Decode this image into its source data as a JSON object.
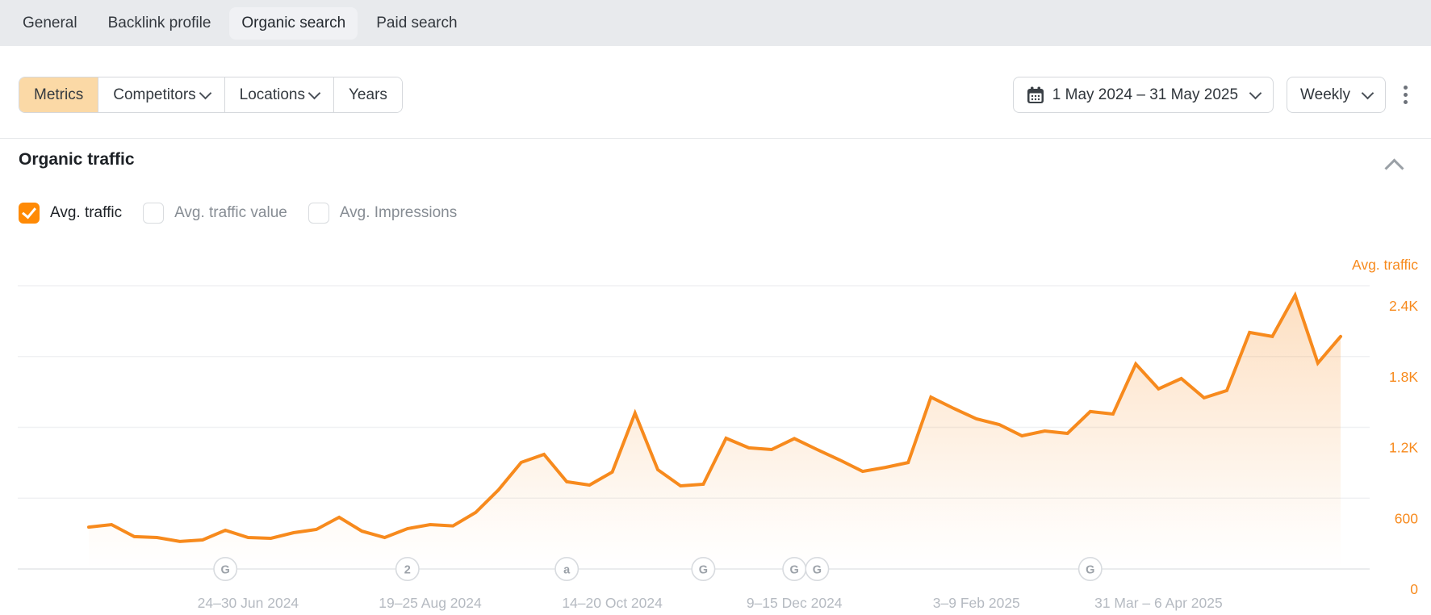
{
  "tabs": [
    {
      "label": "General",
      "active": false
    },
    {
      "label": "Backlink profile",
      "active": false
    },
    {
      "label": "Organic search",
      "active": true
    },
    {
      "label": "Paid search",
      "active": false
    }
  ],
  "toolbar": {
    "segments": [
      {
        "label": "Metrics",
        "active": true
      },
      {
        "label": "Competitors",
        "has_chevron": true
      },
      {
        "label": "Locations",
        "has_chevron": true
      },
      {
        "label": "Years"
      }
    ],
    "date_range": "1 May 2024 – 31 May 2025",
    "granularity": "Weekly"
  },
  "section": {
    "title": "Organic traffic"
  },
  "legend": {
    "checkboxes": [
      {
        "label": "Avg. traffic",
        "checked": true
      },
      {
        "label": "Avg. traffic value",
        "checked": false
      },
      {
        "label": "Avg. Impressions",
        "checked": false
      }
    ]
  },
  "colors": {
    "accent": "#f78a1d",
    "accent_soft": "#fbd9a6",
    "checkbox_checked": "#ff8a05",
    "grid": "#f0f1f3",
    "axis_line": "#e4e6e9",
    "x_label": "#b5bac1",
    "badge_border": "#d8dbdf",
    "badge_text": "#9ca2a9"
  },
  "chart_data": {
    "type": "area",
    "title": "Organic traffic",
    "x_unit": "week",
    "x_range_label": "1 May 2024 – 31 May 2025",
    "series": [
      {
        "name": "Avg. traffic",
        "values": [
          355,
          376,
          274,
          267,
          233,
          246,
          328,
          267,
          260,
          308,
          335,
          438,
          321,
          267,
          342,
          376,
          365,
          479,
          670,
          903,
          971,
          739,
          711,
          821,
          1320,
          841,
          704,
          718,
          1108,
          1026,
          1012,
          1105,
          1012,
          923,
          827,
          861,
          902,
          1456,
          1361,
          1272,
          1224,
          1128,
          1169,
          1149,
          1334,
          1313,
          1737,
          1526,
          1614,
          1450,
          1512,
          2004,
          1970,
          2319,
          1744,
          1970
        ]
      }
    ],
    "x_tick_labels": [
      {
        "index": 7,
        "label": "24–30 Jun 2024"
      },
      {
        "index": 15,
        "label": "19–25 Aug 2024"
      },
      {
        "index": 23,
        "label": "14–20 Oct 2024"
      },
      {
        "index": 31,
        "label": "9–15 Dec 2024"
      },
      {
        "index": 39,
        "label": "3–9 Feb 2025"
      },
      {
        "index": 47,
        "label": "31 Mar – 6 Apr 2025"
      }
    ],
    "event_badges": [
      {
        "index": 6,
        "letter": "G"
      },
      {
        "index": 14,
        "letter": "2"
      },
      {
        "index": 21,
        "letter": "a"
      },
      {
        "index": 27,
        "letter": "G"
      },
      {
        "index": 31,
        "letter": "G"
      },
      {
        "index": 32,
        "letter": "G"
      },
      {
        "index": 44,
        "letter": "G"
      }
    ],
    "y_axis": {
      "title": "Avg. traffic",
      "ticks": [
        {
          "value": 0,
          "label": "0"
        },
        {
          "value": 600,
          "label": "600"
        },
        {
          "value": 1200,
          "label": "1.2K"
        },
        {
          "value": 1800,
          "label": "1.8K"
        },
        {
          "value": 2400,
          "label": "2.4K"
        }
      ]
    },
    "ylim": [
      0,
      2400
    ],
    "grid": true,
    "legend_position": "top-right"
  }
}
